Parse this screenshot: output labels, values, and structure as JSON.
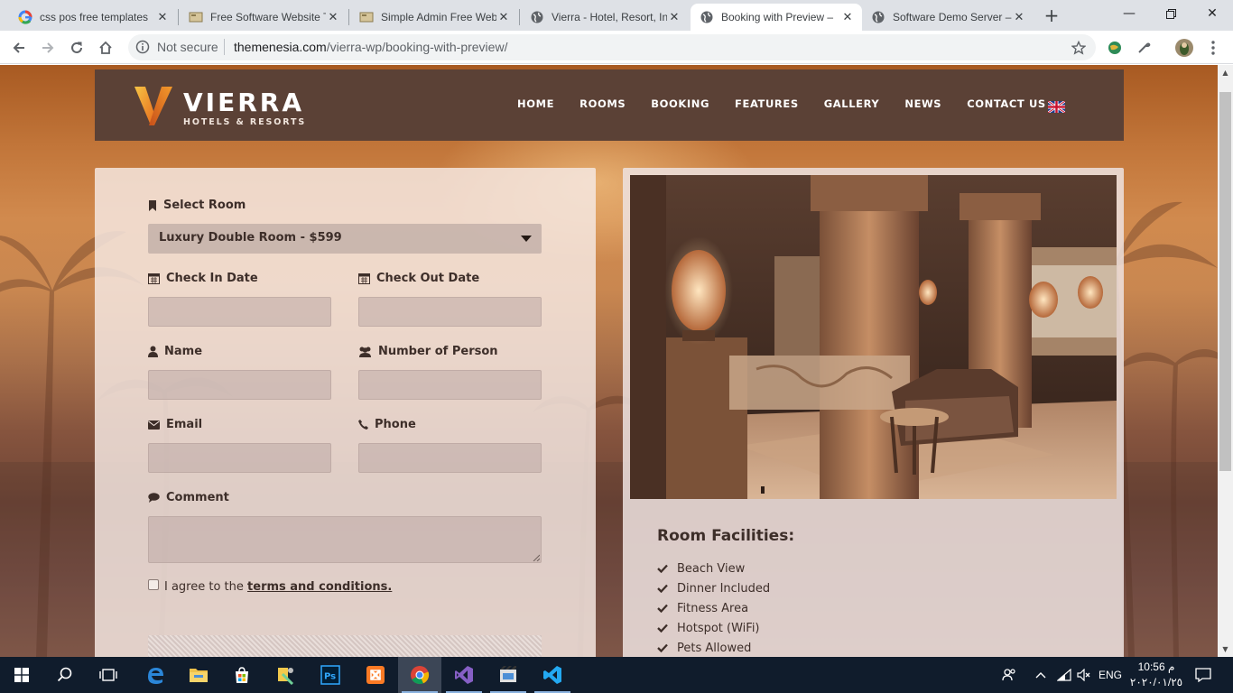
{
  "browser": {
    "tabs": [
      {
        "title": "css pos free templates",
        "icon": "google-icon",
        "active": false
      },
      {
        "title": "Free Software Website T",
        "icon": "site-icon",
        "active": false
      },
      {
        "title": "Simple Admin Free Web",
        "icon": "site-icon",
        "active": false
      },
      {
        "title": "Vierra - Hotel, Resort, In",
        "icon": "globe-icon",
        "active": false
      },
      {
        "title": "Booking with Preview –",
        "icon": "globe-icon",
        "active": true
      },
      {
        "title": "Software Demo Server –",
        "icon": "globe-icon",
        "active": false
      }
    ],
    "security_label": "Not secure",
    "url_host": "themenesia.com",
    "url_path": "/vierra-wp/booking-with-preview/"
  },
  "site": {
    "logo_name": "VIERRA",
    "logo_sub": "HOTELS & RESORTS",
    "nav": [
      "HOME",
      "ROOMS",
      "BOOKING",
      "FEATURES",
      "GALLERY",
      "NEWS",
      "CONTACT US"
    ],
    "colors": {
      "header": "#5b4136",
      "logo_orange": "#e8892a",
      "text": "#3d2e29"
    }
  },
  "form": {
    "select_room_label": "Select Room",
    "select_room_value": "Luxury Double Room - $599",
    "check_in_label": "Check In Date",
    "check_out_label": "Check Out Date",
    "name_label": "Name",
    "persons_label": "Number of Person",
    "email_label": "Email",
    "phone_label": "Phone",
    "comment_label": "Comment",
    "agree_prefix": "I agree to the ",
    "agree_link": "terms and conditions."
  },
  "room": {
    "facilities_title": "Room Facilities:",
    "facilities": [
      "Beach View",
      "Dinner Included",
      "Fitness Area",
      "Hotspot (WiFi)",
      "Pets Allowed"
    ]
  },
  "taskbar": {
    "language": "ENG",
    "time": "10:56 م",
    "date": "٢٠٢٠/٠١/٢٥"
  }
}
